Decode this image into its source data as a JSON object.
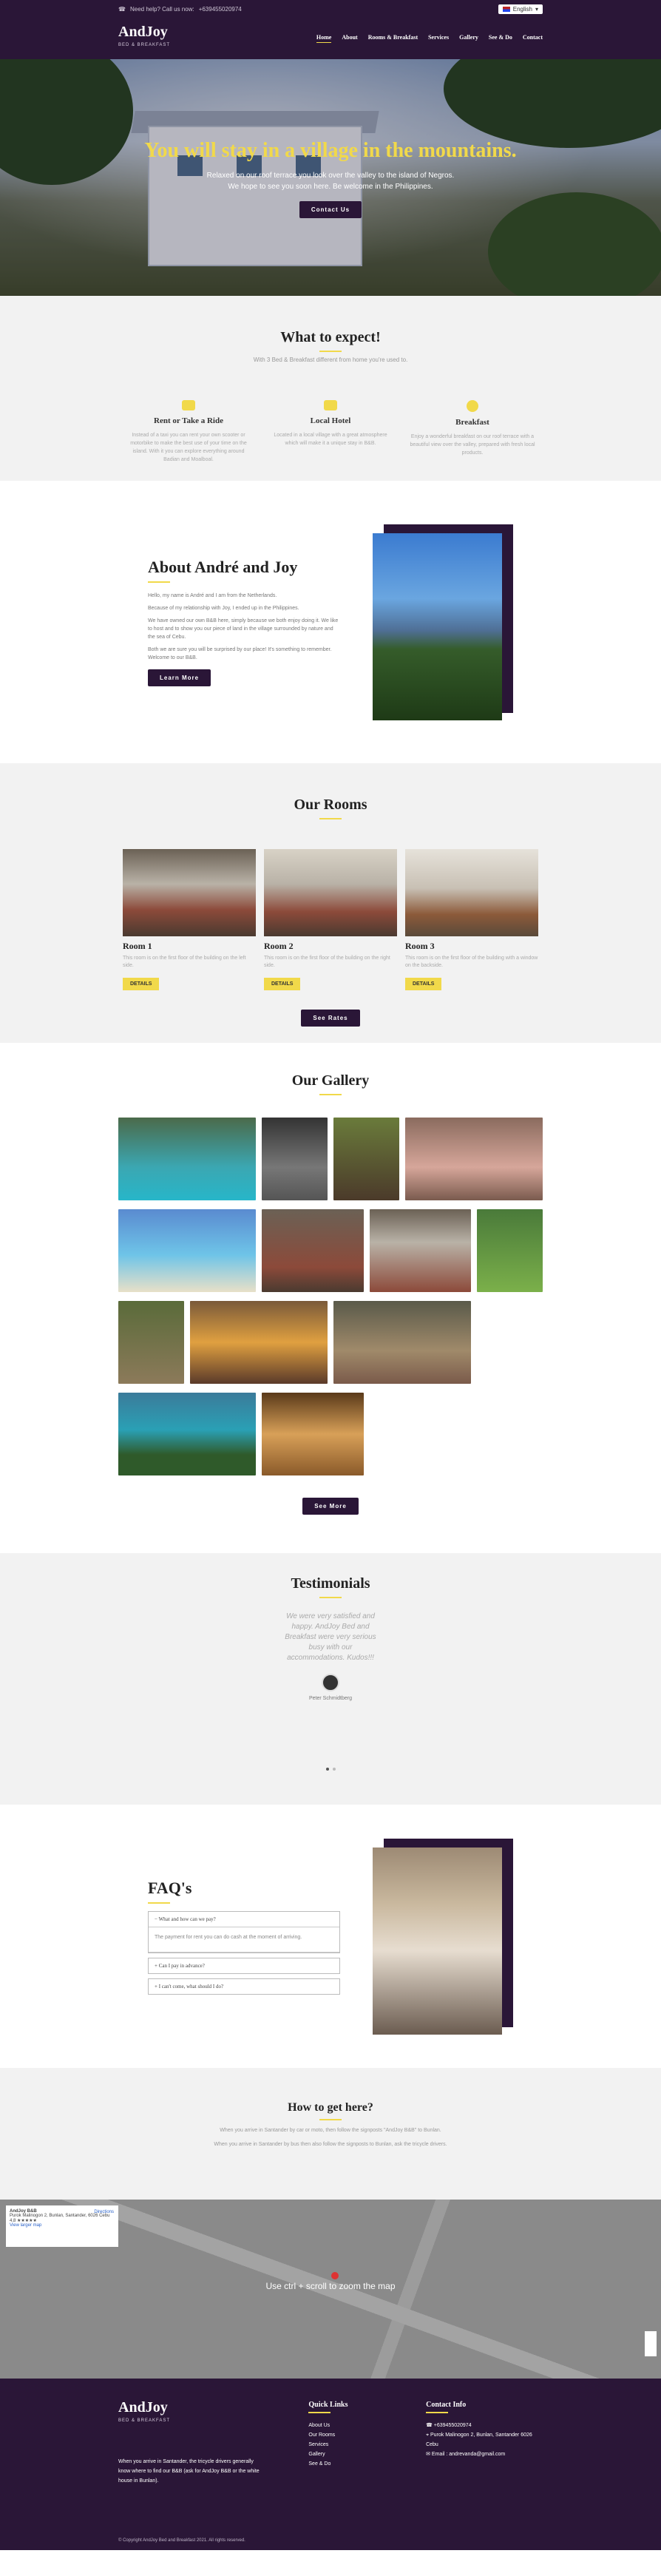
{
  "topbar": {
    "phone_label": "Need help? Call us now:",
    "phone": "+639455020974",
    "language": "English"
  },
  "nav": {
    "brand": "AndJoy",
    "brand_sub": "BED & BREAKFAST",
    "items": [
      "Home",
      "About",
      "Rooms & Breakfast",
      "Services",
      "Gallery",
      "See & Do",
      "Contact"
    ]
  },
  "hero": {
    "title": "You will stay in a village in the mountains.",
    "text1": "Relaxed on our roof terrace you look over the valley to the island of Negros.",
    "text2": "We hope to see you soon here. Be welcome in the Philippines.",
    "button": "Contact Us"
  },
  "expect": {
    "title": "What to expect!",
    "subtitle": "With 3 Bed & Breakfast different from home you're used to.",
    "features": [
      {
        "icon": "car-icon",
        "title": "Rent or Take a Ride",
        "text": "Instead of a taxi you can rent your own scooter or motorbike to make the best use of your time on the island. With it you can explore everything around Badian and Moalboal."
      },
      {
        "icon": "bed-icon",
        "title": "Local Hotel",
        "text": "Located in a local village with a great atmosphere which will make it a unique stay in B&B."
      },
      {
        "icon": "breakfast-icon",
        "title": "Breakfast",
        "text": "Enjoy a wonderful breakfast on our roof terrace with a beautiful view over the valley, prepared with fresh local products."
      }
    ]
  },
  "about": {
    "title": "About André and Joy",
    "paragraphs": [
      "Hello, my name is André and I am from the Netherlands.",
      "Because of my relationship with Joy, I ended up in the Philippines.",
      "We have owned our own B&B here, simply because we both enjoy doing it. We like to host and to show you our piece of land in the village surrounded by nature and the sea of Cebu.",
      "Both we are sure you will be surprised by our place! It's something to remember. Welcome to our B&B."
    ],
    "button": "Learn More"
  },
  "rooms": {
    "title": "Our Rooms",
    "items": [
      {
        "name": "Room 1",
        "text": "This room is on the first floor of the building on the left side.",
        "button": "DETAILS"
      },
      {
        "name": "Room 2",
        "text": "This room is on the first floor of the building on the right side.",
        "button": "DETAILS"
      },
      {
        "name": "Room 3",
        "text": "This room is on the first floor of the building with a window on the backside.",
        "button": "DETAILS"
      }
    ],
    "button": "See Rates"
  },
  "gallery": {
    "title": "Our Gallery",
    "button": "See More"
  },
  "testimonials": {
    "title": "Testimonials",
    "quote": "We were very satisfied and happy. AndJoy Bed and Breakfast were very serious busy with our accommodations. Kudos!!!",
    "name": "Peter Schmidtberg"
  },
  "faq": {
    "title": "FAQ's",
    "items": [
      {
        "q": "What and how can we pay?",
        "a": "The payment for rent you can do cash at the moment of arriving."
      },
      {
        "q": "Can I pay in advance?"
      },
      {
        "q": "I can't come, what should I do?"
      }
    ]
  },
  "howto": {
    "title": "How to get here?",
    "p1": "When you arrive in Santander by car or moto, then follow the signposts \"AndJoy B&B\" to Bunlan.",
    "p2": "When you arrive in Santander by bus then also follow the signposts to Bunlan, ask the tricycle drivers."
  },
  "map": {
    "card_title": "AndJoy B&B",
    "card_address": "Purok Malinogon 2, Bunlan, Santander, 6026 Cebu",
    "card_rating": "4.8",
    "card_link": "View larger map",
    "directions": "Directions",
    "message": "Use ctrl + scroll to zoom the map",
    "pin_label": "AndJoy B&B"
  },
  "footer": {
    "about": "When you arrive in Santander, the tricycle drivers generally know where to find our B&B (ask for AndJoy B&B or the white house in Bunlan).",
    "quick_title": "Quick Links",
    "links": [
      "About Us",
      "Our Rooms",
      "Services",
      "Gallery",
      "See & Do"
    ],
    "contact_title": "Contact Info",
    "phone": "+639455020974",
    "address": "Purok Malinogon 2, Bunlan, Santander 6026 Cebu",
    "email": "Email : andrevanda@gmail.com",
    "copyright": "© Copyright AndJoy Bed and Breakfast 2021. All rights reserved."
  }
}
